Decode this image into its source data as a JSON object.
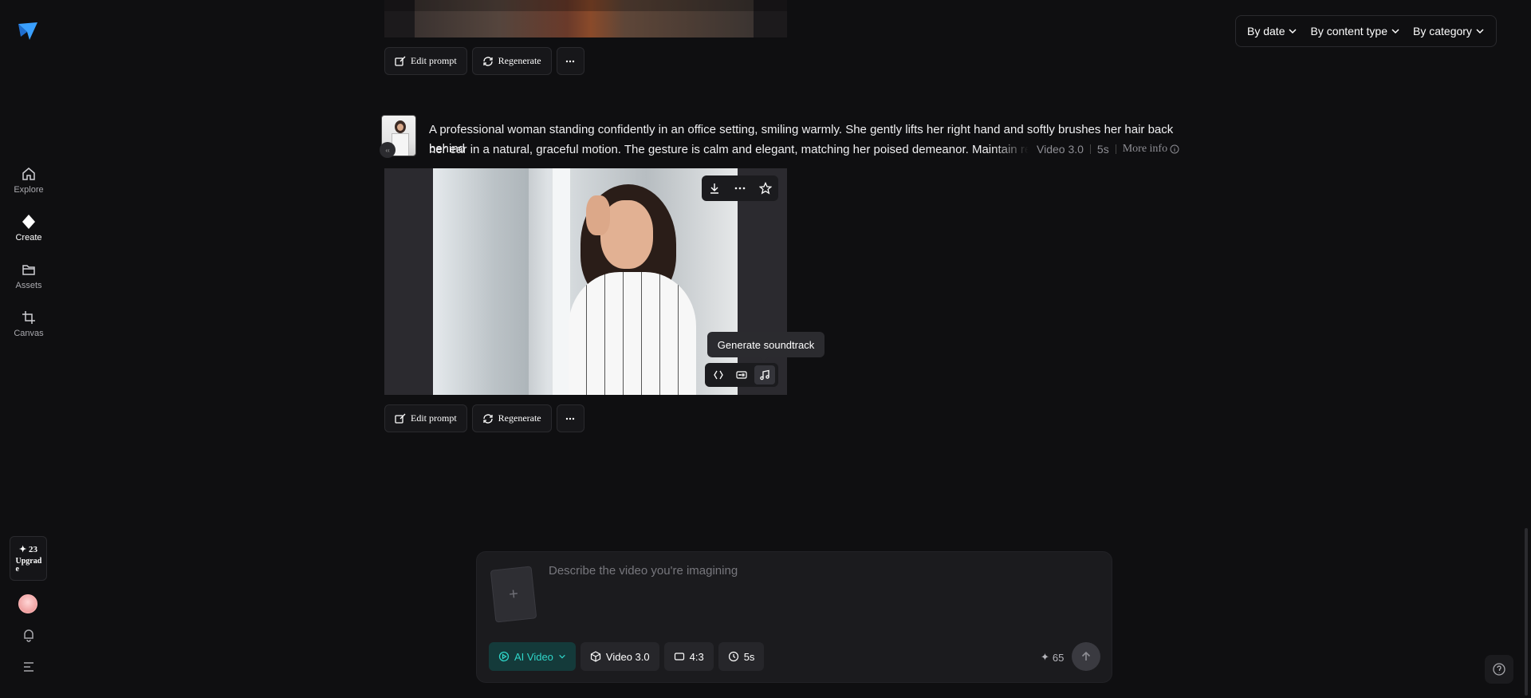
{
  "sidebar": {
    "items": [
      {
        "label": "Explore",
        "icon": "home-icon"
      },
      {
        "label": "Create",
        "icon": "diamond-icon"
      },
      {
        "label": "Assets",
        "icon": "folder-icon"
      },
      {
        "label": "Canvas",
        "icon": "crop-icon"
      }
    ],
    "credits": "✦ 23",
    "upgrade_label": "Upgrad e"
  },
  "filters": {
    "by_date": "By date",
    "by_content_type": "By content type",
    "by_category": "By category"
  },
  "actions": {
    "edit_prompt": "Edit prompt",
    "regenerate": "Regenerate"
  },
  "prompt": {
    "line1": "A professional woman standing confidently in an office setting, smiling warmly. She gently lifts her right hand and softly brushes her hair back behind",
    "line2": "her ear in a natural, graceful motion. The gesture is calm and elegant, matching her poised demeanor. Maintain realistic",
    "model": "Video 3.0",
    "duration": "5s",
    "more_info": "More info",
    "thumb_badge": "‹‹"
  },
  "video": {
    "tooltip": "Generate soundtrack"
  },
  "composer": {
    "placeholder": "Describe the video you're imagining",
    "mode": "AI Video",
    "model": "Video 3.0",
    "ratio": "4:3",
    "duration": "5s",
    "credits": "65"
  },
  "colors": {
    "background": "#0f0f11",
    "accent": "#2fd6c9",
    "logo": "#3aa0ff"
  }
}
